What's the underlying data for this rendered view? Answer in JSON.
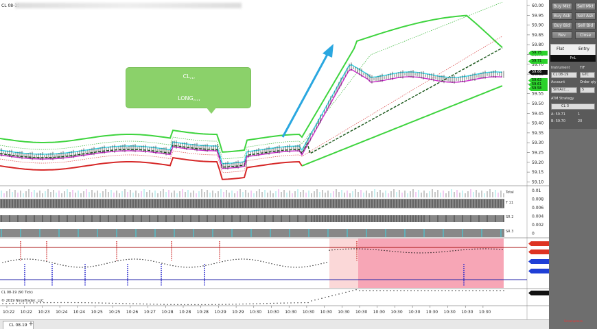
{
  "chart": {
    "title": "CL 08-19",
    "bubble_line1": "CL,,,",
    "bubble_line2": "LONG,,,,",
    "indicator_label": "CL 08-19 (90 Tick)",
    "copyright_label": "© 2019 NinjaTrader, LLC",
    "tab_label": "CL 08.19",
    "tab_add": "+"
  },
  "price_axis": {
    "ticks": [
      "60.00",
      "59.95",
      "59.90",
      "59.85",
      "59.80",
      "59.75",
      "59.70",
      "59.65",
      "59.60",
      "59.55",
      "59.50",
      "59.45",
      "59.40",
      "59.35",
      "59.30",
      "59.25",
      "59.20",
      "59.15",
      "59.10"
    ],
    "tags": [
      {
        "text": "59.75",
        "style": "green"
      },
      {
        "text": "59.71",
        "style": "green"
      },
      {
        "text": "59.66",
        "style": "black"
      },
      {
        "text": "59.63",
        "style": "green"
      },
      {
        "text": "59.61",
        "style": "green"
      },
      {
        "text": "59.58",
        "style": "green"
      }
    ]
  },
  "sub_axis": {
    "ticks": [
      "0.01",
      "0.008",
      "0.006",
      "0.004",
      "0.002",
      "0"
    ],
    "labels": [
      "Total",
      "T 11",
      "SR 2",
      "SR 3"
    ]
  },
  "time_axis": {
    "labels": [
      "10:22",
      "10:22",
      "10:23",
      "10:24",
      "10:24",
      "10:25",
      "10:25",
      "10:26",
      "10:27",
      "10:28",
      "10:28",
      "10:28",
      "10:29",
      "10:29",
      "10:30",
      "10:30",
      "10:30",
      "10:30",
      "10:30",
      "10:30",
      "10:30",
      "10:30",
      "10:30",
      "10:30",
      "10:30",
      "10:30",
      "10:30",
      "10:30"
    ]
  },
  "panel": {
    "buttons": [
      {
        "left": "Buy Mkt",
        "right": "Sell Mkt"
      },
      {
        "left": "Buy Ask",
        "right": "Sell Ask"
      },
      {
        "left": "Buy Bid",
        "right": "Sell Bid"
      },
      {
        "left": "Rev",
        "right": "Close"
      }
    ],
    "position_label": "Flat",
    "entry_label": "Entry",
    "pnl_label": "PnL",
    "instrument_label": "Instrument",
    "instrument_value": "CL 08-19",
    "tif_label": "TIF",
    "tif_value": "GTC",
    "account_label": "Account",
    "account_value": "SimAcc...",
    "order_qty_label": "Order qty",
    "order_qty_value": "5",
    "atm_label": "ATM Strategy",
    "atm_value": "CL 3",
    "ask_label": "A: 59.71",
    "ask_qty": "1",
    "bid_label": "B: 59.70",
    "bid_qty": "20",
    "watermark": "Screenpresso"
  },
  "colors": {
    "band_green": "#3ed43e",
    "band_red": "#d62828",
    "cyan": "#3cd6e6",
    "magenta": "#cc33cc",
    "arrow": "#2aa7e0",
    "pink_zone": "#f7a6b6"
  }
}
